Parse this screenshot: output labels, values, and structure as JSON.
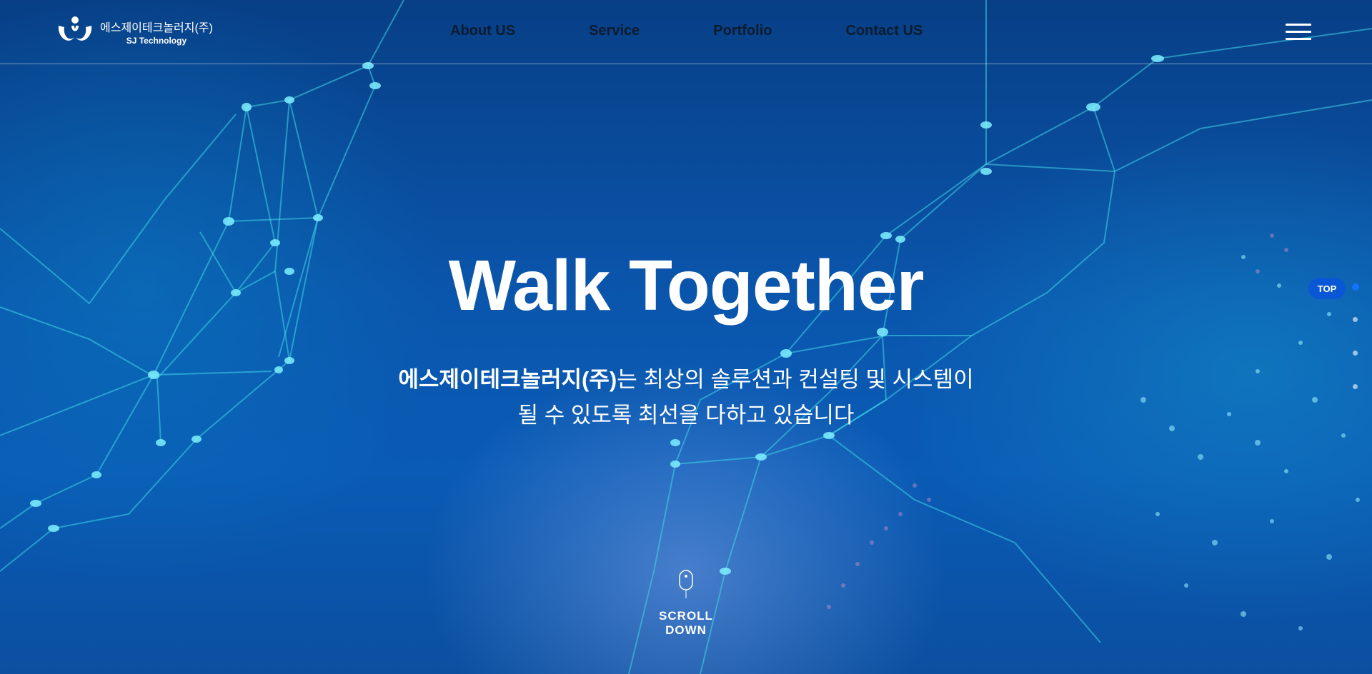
{
  "logo": {
    "name_kr": "에스제이테크놀러지(주)",
    "name_en": "SJ Technology"
  },
  "nav": {
    "items": [
      {
        "label": "About US"
      },
      {
        "label": "Service"
      },
      {
        "label": "Portfolio"
      },
      {
        "label": "Contact US"
      }
    ]
  },
  "hero": {
    "title": "Walk Together",
    "subtitle_bold": "에스제이테크놀러지(주)",
    "subtitle_line1": "는 최상의 솔루션과 컨설팅 및 시스템이",
    "subtitle_line2": "될 수 있도록 최선을 다하고 있습니다"
  },
  "scroll": {
    "label": "SCROLL DOWN"
  },
  "side": {
    "top_label": "TOP",
    "active_index": 0
  },
  "icons": {
    "menu": "hamburger-menu-icon",
    "mouse": "mouse-scroll-icon"
  },
  "colors": {
    "background": "#0a56ad",
    "accent": "#0a57d6",
    "nav_text": "#0d1b2e"
  }
}
